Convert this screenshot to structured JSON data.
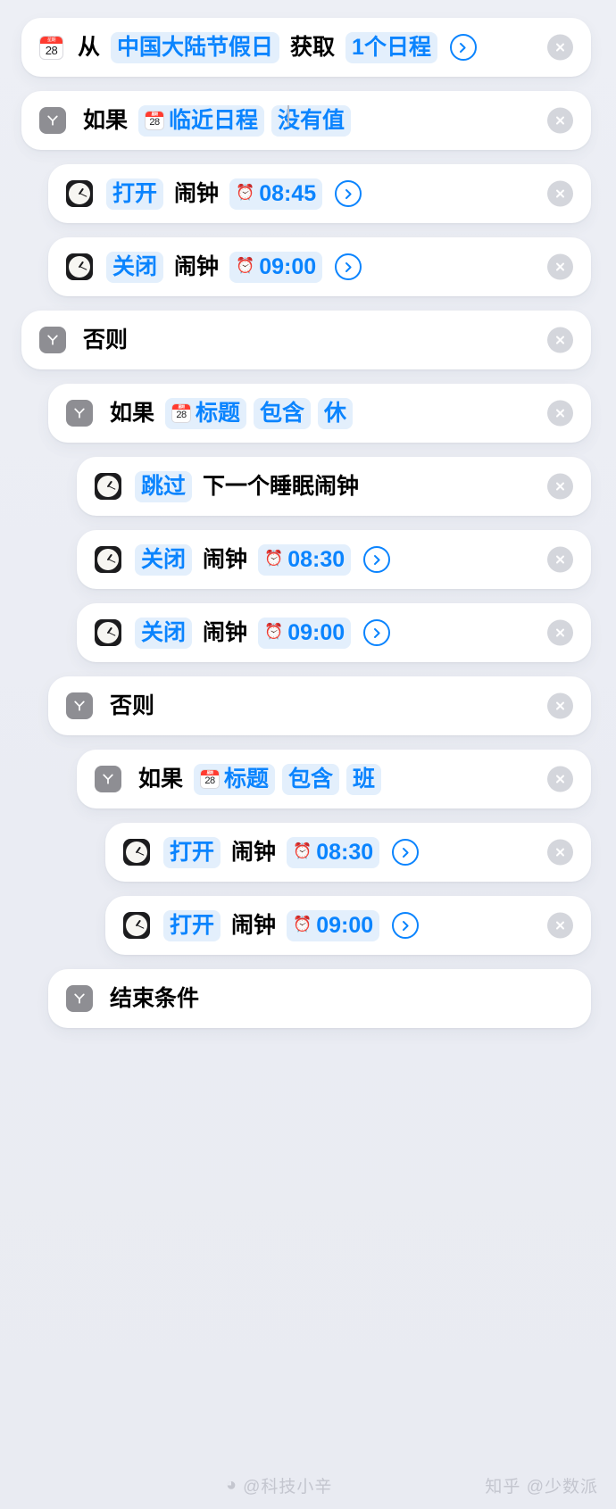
{
  "app": {
    "name": "Shortcuts Editor",
    "language": "zh-Hans",
    "background_color": "#eceef4",
    "card_color": "#ffffff",
    "accent_color": "#0b84fe",
    "token_bg_color": "#e3effc",
    "branch_icon_color": "#8e8e93"
  },
  "icons": {
    "calendar": "calendar-icon",
    "calendar_weekday_label": "星期",
    "calendar_day": "28",
    "branch": "branch-icon",
    "clock_app": "clock-app-icon",
    "alarm": "⏰",
    "chevron_right": "chevron-right-icon",
    "remove": "remove-icon",
    "weibo": "weibo-icon"
  },
  "actions": [
    {
      "id": "get-calendar-events",
      "indent": 0,
      "icon": "calendar-icon",
      "parts": [
        {
          "type": "text",
          "value": "从"
        },
        {
          "type": "token",
          "value": "中国大陆节假日"
        },
        {
          "type": "text",
          "value": "获取"
        },
        {
          "type": "token",
          "value": "1个日程"
        }
      ],
      "has_chevron": true,
      "has_remove": true
    },
    {
      "id": "if-upcoming-event-has-no-value",
      "indent": 0,
      "icon": "branch-icon",
      "parts": [
        {
          "type": "text",
          "value": "如果"
        },
        {
          "type": "token-cal",
          "value": "临近日程"
        },
        {
          "type": "token",
          "value": "没有值"
        }
      ],
      "has_chevron": false,
      "has_remove": true
    },
    {
      "id": "turn-on-alarm-0845",
      "indent": 1,
      "icon": "clock-app-icon",
      "parts": [
        {
          "type": "token",
          "value": "打开"
        },
        {
          "type": "text",
          "value": "闹钟"
        },
        {
          "type": "token-alarm",
          "value": "08:45"
        }
      ],
      "has_chevron": true,
      "has_remove": true
    },
    {
      "id": "turn-off-alarm-0900-a",
      "indent": 1,
      "icon": "clock-app-icon",
      "parts": [
        {
          "type": "token",
          "value": "关闭"
        },
        {
          "type": "text",
          "value": "闹钟"
        },
        {
          "type": "token-alarm",
          "value": "09:00"
        }
      ],
      "has_chevron": true,
      "has_remove": true
    },
    {
      "id": "otherwise-outer",
      "indent": 0,
      "icon": "branch-icon",
      "parts": [
        {
          "type": "text",
          "value": "否则"
        }
      ],
      "has_chevron": false,
      "has_remove": true
    },
    {
      "id": "if-title-contains-xiu",
      "indent": 1,
      "icon": "branch-icon",
      "parts": [
        {
          "type": "text",
          "value": "如果"
        },
        {
          "type": "token-cal",
          "value": "标题"
        },
        {
          "type": "token",
          "value": "包含"
        },
        {
          "type": "token",
          "value": "休"
        }
      ],
      "has_chevron": false,
      "has_remove": true
    },
    {
      "id": "skip-next-sleep-alarm",
      "indent": 2,
      "icon": "clock-app-icon",
      "parts": [
        {
          "type": "token",
          "value": "跳过"
        },
        {
          "type": "text",
          "value": "下一个睡眠闹钟"
        }
      ],
      "has_chevron": false,
      "has_remove": true
    },
    {
      "id": "turn-off-alarm-0830",
      "indent": 2,
      "icon": "clock-app-icon",
      "parts": [
        {
          "type": "token",
          "value": "关闭"
        },
        {
          "type": "text",
          "value": "闹钟"
        },
        {
          "type": "token-alarm",
          "value": "08:30"
        }
      ],
      "has_chevron": true,
      "has_remove": true
    },
    {
      "id": "turn-off-alarm-0900-b",
      "indent": 2,
      "icon": "clock-app-icon",
      "parts": [
        {
          "type": "token",
          "value": "关闭"
        },
        {
          "type": "text",
          "value": "闹钟"
        },
        {
          "type": "token-alarm",
          "value": "09:00"
        }
      ],
      "has_chevron": true,
      "has_remove": true
    },
    {
      "id": "otherwise-inner",
      "indent": 1,
      "icon": "branch-icon",
      "parts": [
        {
          "type": "text",
          "value": "否则"
        }
      ],
      "has_chevron": false,
      "has_remove": true
    },
    {
      "id": "if-title-contains-ban",
      "indent": 2,
      "icon": "branch-icon",
      "parts": [
        {
          "type": "text",
          "value": "如果"
        },
        {
          "type": "token-cal",
          "value": "标题"
        },
        {
          "type": "token",
          "value": "包含"
        },
        {
          "type": "token",
          "value": "班"
        }
      ],
      "has_chevron": false,
      "has_remove": true
    },
    {
      "id": "turn-on-alarm-0830",
      "indent": 3,
      "icon": "clock-app-icon",
      "parts": [
        {
          "type": "token",
          "value": "打开"
        },
        {
          "type": "text",
          "value": "闹钟"
        },
        {
          "type": "token-alarm",
          "value": "08:30"
        }
      ],
      "has_chevron": true,
      "has_remove": true
    },
    {
      "id": "turn-on-alarm-0900",
      "indent": 3,
      "icon": "clock-app-icon",
      "parts": [
        {
          "type": "token",
          "value": "打开"
        },
        {
          "type": "text",
          "value": "闹钟"
        },
        {
          "type": "token-alarm",
          "value": "09:00"
        }
      ],
      "has_chevron": true,
      "has_remove": true
    },
    {
      "id": "end-if",
      "indent": 1,
      "icon": "branch-icon",
      "parts": [
        {
          "type": "text",
          "value": "结束条件"
        }
      ],
      "has_chevron": false,
      "has_remove": false
    }
  ],
  "watermarks": {
    "weibo_handle": "@科技小辛",
    "zhihu_handle": "知乎 @少数派"
  }
}
